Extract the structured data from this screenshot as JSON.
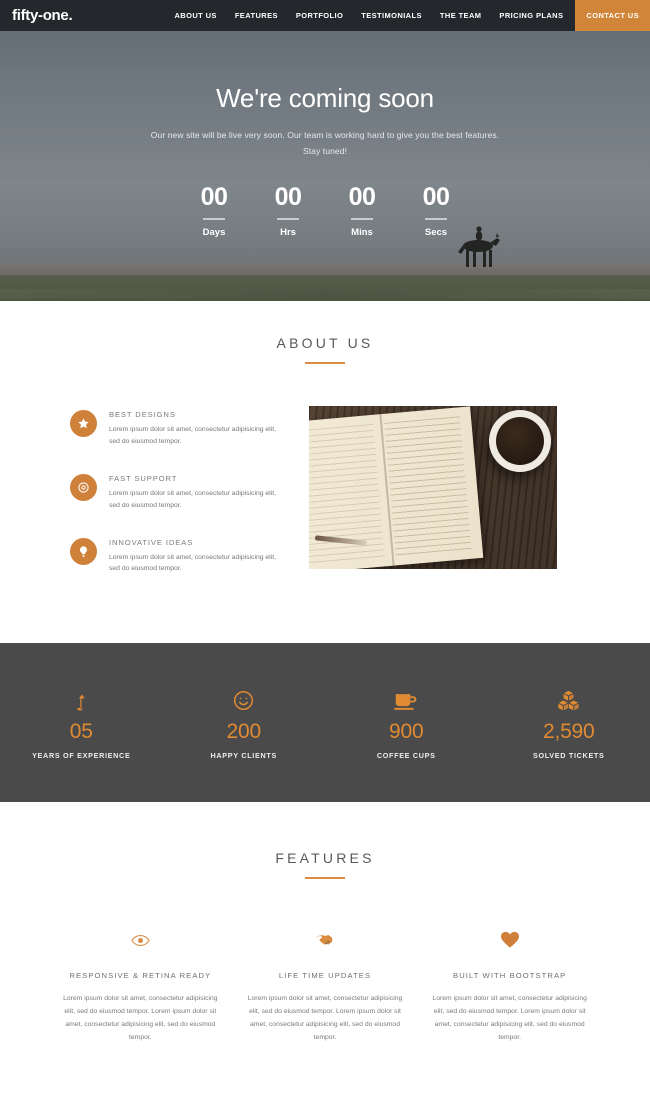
{
  "navbar": {
    "logo": "fifty-one.",
    "items": [
      {
        "label": "ABOUT US"
      },
      {
        "label": "FEATURES"
      },
      {
        "label": "PORTFOLIO"
      },
      {
        "label": "TESTIMONIALS"
      },
      {
        "label": "THE TEAM"
      },
      {
        "label": "PRICING PLANS"
      }
    ],
    "cta": "CONTACT US",
    "background": "#24272b",
    "accent": "#d18539"
  },
  "hero": {
    "title": "We're coming soon",
    "subtitle": "Our new site will be live very soon. Our team is working hard to give you the best features. Stay tuned!",
    "countdown": [
      {
        "value": "00",
        "label": "Days"
      },
      {
        "value": "00",
        "label": "Hrs"
      },
      {
        "value": "00",
        "label": "Mins"
      },
      {
        "value": "00",
        "label": "Secs"
      }
    ]
  },
  "about": {
    "title": "ABOUT US",
    "items": [
      {
        "icon": "star-icon",
        "title": "BEST DESIGNS",
        "text": "Lorem ipsum dolor sit amet, consectetur adipisicing elit, sed do eiusmod tempor."
      },
      {
        "icon": "clock-icon",
        "title": "FAST SUPPORT",
        "text": "Lorem ipsum dolor sit amet, consectetur adipisicing elit, sed do eiusmod tempor."
      },
      {
        "icon": "lightbulb-icon",
        "title": "INNOVATIVE IDEAS",
        "text": "Lorem ipsum dolor sit amet, consectetur adipisicing elit, sed do eiusmod tempor."
      }
    ]
  },
  "counters": {
    "background": "#4a4a4a",
    "accent": "#e08a33",
    "items": [
      {
        "icon": "growth-arrow-icon",
        "value": "05",
        "label": "YEARS OF EXPERIENCE"
      },
      {
        "icon": "smiley-icon",
        "value": "200",
        "label": "HAPPY CLIENTS"
      },
      {
        "icon": "coffee-cup-icon",
        "value": "900",
        "label": "COFFEE CUPS"
      },
      {
        "icon": "boxes-icon",
        "value": "2,590",
        "label": "SOLVED TICKETS"
      }
    ]
  },
  "features": {
    "title": "FEATURES",
    "items": [
      {
        "icon": "eye-icon",
        "title": "RESPONSIVE & RETINA READY",
        "text": "Lorem ipsum dolor sit amet, consectetur adipisicing elit, sed do eiusmod tempor. Lorem ipsum dolor sit amet, consectetur adipisicing elit, sed do eiusmod tempor."
      },
      {
        "icon": "handshake-icon",
        "title": "LIFE TIME UPDATES",
        "text": "Lorem ipsum dolor sit amet, consectetur adipisicing elit, sed do eiusmod tempor. Lorem ipsum dolor sit amet, consectetur adipisicing elit, sed do eiusmod tempor."
      },
      {
        "icon": "heart-icon",
        "title": "BUILT WITH BOOTSTRAP",
        "text": "Lorem ipsum dolor sit amet, consectetur adipisicing elit, sed do eiusmod tempor. Lorem ipsum dolor sit amet, consectetur adipisicing elit, sed do eiusmod tempor."
      }
    ]
  }
}
